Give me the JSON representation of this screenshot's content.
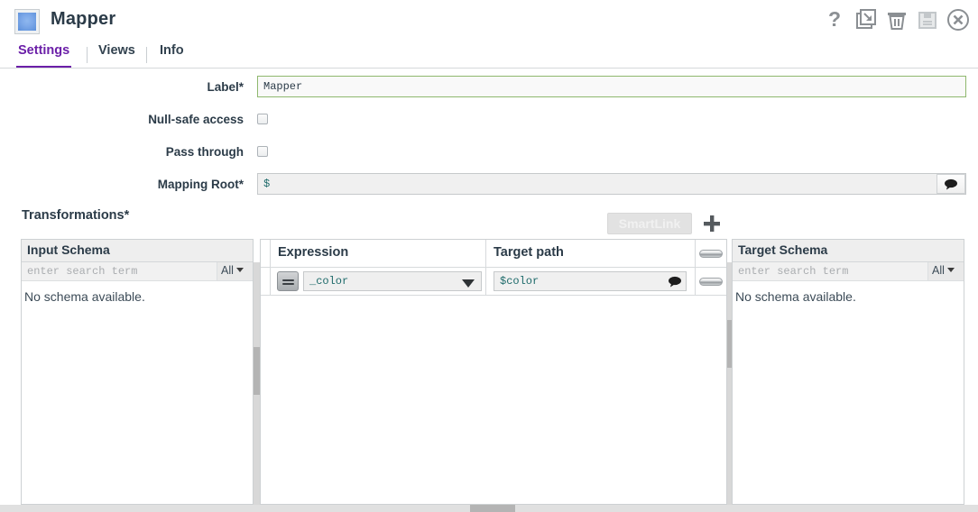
{
  "window": {
    "title": "Mapper",
    "icon": "mapper-app-icon",
    "buttons": [
      {
        "name": "help-icon",
        "glyph": "?",
        "label": "Help",
        "enabled": true
      },
      {
        "name": "minimize-icon",
        "glyph": "↘",
        "label": "Minimize",
        "enabled": true
      },
      {
        "name": "delete-icon",
        "glyph": "🗑",
        "label": "Delete",
        "enabled": true
      },
      {
        "name": "save-icon",
        "glyph": "💾",
        "label": "Save",
        "enabled": false
      },
      {
        "name": "close-icon",
        "glyph": "⊗",
        "label": "Close",
        "enabled": true
      }
    ]
  },
  "tabs": [
    {
      "label": "Settings",
      "active": true
    },
    {
      "label": "Views",
      "active": false
    },
    {
      "label": "Info",
      "active": false
    }
  ],
  "form": {
    "label_field": {
      "label": "Label*",
      "value": "Mapper",
      "placeholder": ""
    },
    "null_safe": {
      "label": "Null-safe access",
      "checked": false
    },
    "pass_through": {
      "label": "Pass through",
      "checked": false
    },
    "mapping_root": {
      "label": "Mapping Root*",
      "value": "$",
      "placeholder": "",
      "bubble_icon": "comment-bubble-icon"
    }
  },
  "transformations": {
    "title": "Transformations*",
    "smartlink_label": "SmartLink",
    "smartlink_enabled": false,
    "add_label": "+",
    "columns": [
      "Expression",
      "Target path"
    ],
    "rows": [
      {
        "mode_label": "=",
        "expression": "_color",
        "target_path": "$color",
        "bubble_icon": "comment-bubble-icon",
        "remove_label": "—"
      }
    ],
    "header_remove_label": "—"
  },
  "panels": {
    "input_schema": {
      "title": "Input Schema",
      "search_placeholder": "enter search term",
      "search_value": "",
      "filter_label": "All",
      "empty_text": "No schema available."
    },
    "target_schema": {
      "title": "Target Schema",
      "search_placeholder": "enter search term",
      "search_value": "",
      "filter_label": "All",
      "empty_text": "No schema available."
    }
  },
  "colors": {
    "accent": "#6b1fa8",
    "text": "#2b3b48",
    "focus_border": "#8fb86e",
    "code_text": "#1e6b6b",
    "panel_head_bg": "#eeeeee"
  }
}
